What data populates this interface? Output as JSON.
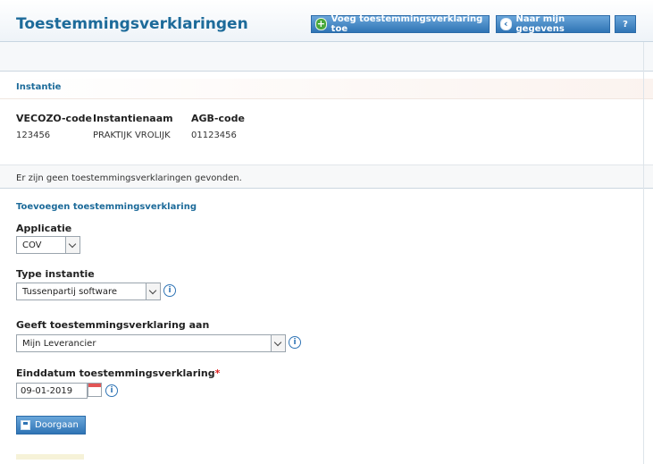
{
  "header": {
    "title": "Toestemmingsverklaringen",
    "add_button": "Voeg toestemmingsverklaring toe",
    "back_button": "Naar mijn gegevens",
    "help_button": "?"
  },
  "instantie": {
    "section_title": "Instantie",
    "columns": [
      "VECOZO-code",
      "Instantienaam",
      "AGB-code"
    ],
    "values": [
      "123456",
      "PRAKTIJK VROLIJK",
      "01123456"
    ]
  },
  "empty_message": "Er zijn geen toestemmingsverklaringen gevonden.",
  "form": {
    "section_title": "Toevoegen toestemmingsverklaring",
    "applicatie_label": "Applicatie",
    "applicatie_value": "COV",
    "type_label": "Type instantie",
    "type_value": "Tussenpartij software",
    "geeft_label": "Geeft toestemmingsverklaring aan",
    "geeft_value": "Mijn Leverancier",
    "einddatum_label": "Einddatum toestemmingsverklaring",
    "required_mark": "*",
    "einddatum_value": "09-01-2019",
    "submit_button": "Doorgaan"
  },
  "icons": {
    "add": "plus-circle-icon",
    "back": "arrow-left-circle-icon",
    "info": "info-icon",
    "calendar": "calendar-icon",
    "save": "save-icon"
  },
  "colors": {
    "title": "#1d6b9a",
    "button": "#2f74b5",
    "add_icon": "#48a83a"
  }
}
